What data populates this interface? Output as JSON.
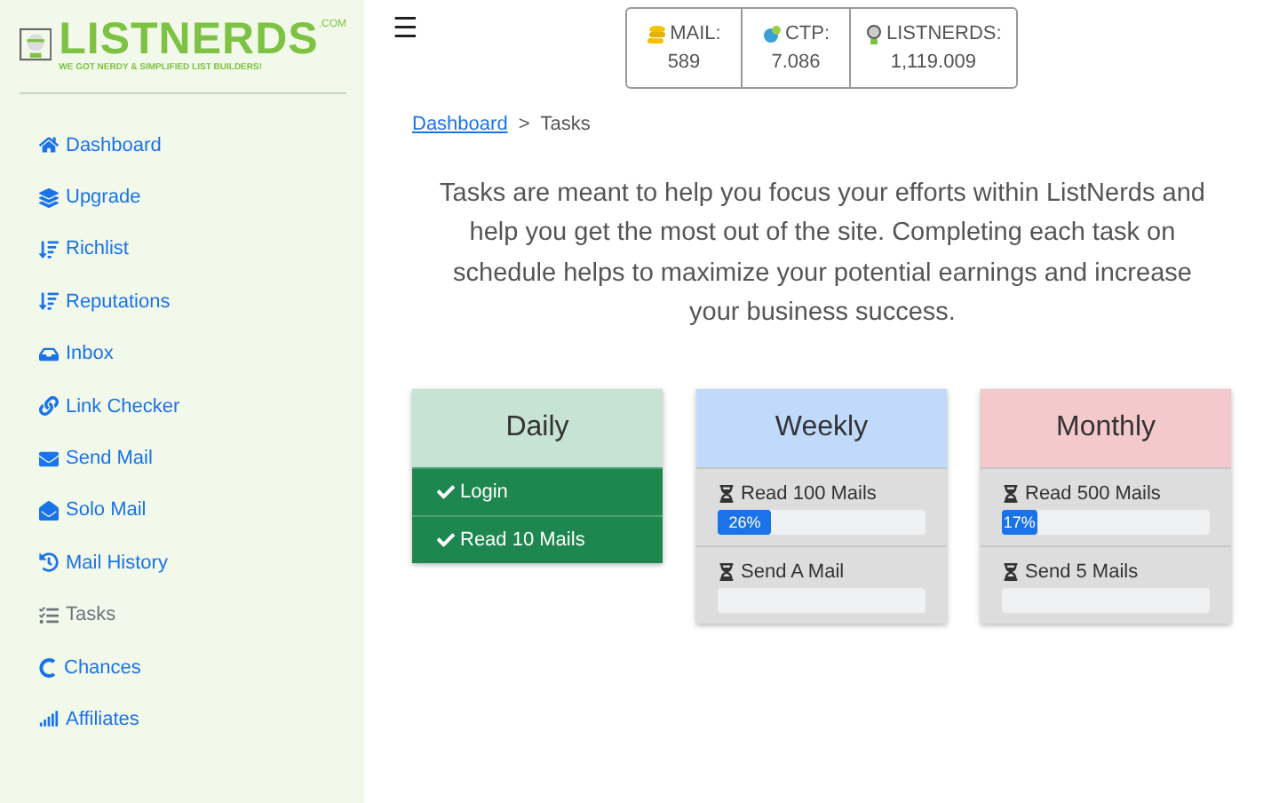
{
  "logo": {
    "name": "LISTNERDS",
    "suffix": ".COM",
    "tagline": "WE GOT NERDY & SIMPLIFIED LIST BUILDERS!"
  },
  "sidebar": {
    "items": [
      {
        "label": "Dashboard",
        "selected": false
      },
      {
        "label": "Upgrade",
        "selected": false
      },
      {
        "label": "Richlist",
        "selected": false
      },
      {
        "label": "Reputations",
        "selected": false
      },
      {
        "label": "Inbox",
        "selected": false
      },
      {
        "label": "Link Checker",
        "selected": false
      },
      {
        "label": "Send Mail",
        "selected": false
      },
      {
        "label": "Solo Mail",
        "selected": false
      },
      {
        "label": "Mail History",
        "selected": false
      },
      {
        "label": "Tasks",
        "selected": true
      },
      {
        "label": "Chances",
        "selected": false
      },
      {
        "label": "Affiliates",
        "selected": false
      }
    ]
  },
  "menu_toggle": "☰",
  "stats": [
    {
      "label": "MAIL:",
      "value": "589"
    },
    {
      "label": "CTP:",
      "value": "7.086"
    },
    {
      "label": "LISTNERDS:",
      "value": "1,119.009"
    }
  ],
  "breadcrumb": {
    "link": "Dashboard",
    "separator": ">",
    "current": "Tasks"
  },
  "intro": "Tasks are meant to help you focus your efforts within ListNerds and help you get the most out of the site. Completing each task on schedule helps to maximize your potential earnings and increase your business success.",
  "cards": [
    {
      "title": "Daily",
      "color": "#c6e3d4",
      "tasks": [
        {
          "kind": "done",
          "label": "Login"
        },
        {
          "kind": "done",
          "label": "Read 10 Mails"
        }
      ]
    },
    {
      "title": "Weekly",
      "color": "#c1dafc",
      "tasks": [
        {
          "kind": "progress",
          "label": "Read 100 Mails",
          "level": 0.26,
          "reading": "26%"
        },
        {
          "kind": "progress",
          "label": "Send A Mail"
        }
      ]
    },
    {
      "title": "Monthly",
      "color": "#f4c9cc",
      "tasks": [
        {
          "kind": "progress",
          "label": "Read 500 Mails",
          "level": 0.17,
          "reading": "17%"
        },
        {
          "kind": "progress",
          "label": "Send 5 Mails"
        }
      ]
    }
  ]
}
